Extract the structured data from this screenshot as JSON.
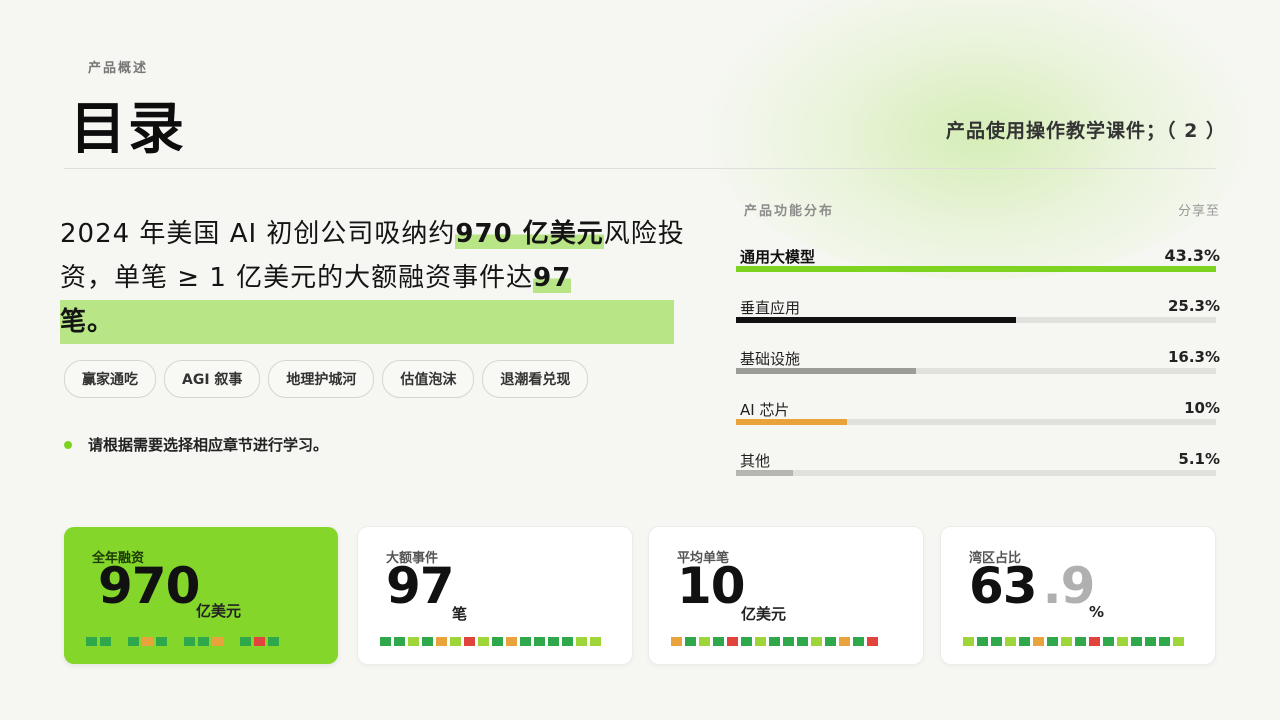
{
  "header": {
    "eyebrow": "产品概述",
    "title": "目录",
    "subtitle": "产品使用操作教学课件；（ 2 ）"
  },
  "lead": {
    "part1": "2024 年美国 AI 初创公司吸纳约",
    "highlight1": "970 亿美元",
    "part2": "风险投资，单笔 ≥ 1 亿美元的大额融资事件达",
    "highlight2": "97",
    "part3": "笔。"
  },
  "tags": [
    "赢家通吃",
    "AGI 叙事",
    "地理护城河",
    "估值泡沫",
    "退潮看兑现"
  ],
  "note": "请根据需要选择相应章节进行学习。",
  "distribution": {
    "title": "产品功能分布",
    "share_label": "分享至",
    "items": [
      {
        "label": "通用大模型",
        "value_text": "43.3%",
        "value": 1.0,
        "color": "#7ed321"
      },
      {
        "label": "垂直应用",
        "value_text": "25.3%",
        "value": 0.584,
        "color": "#111111"
      },
      {
        "label": "基础设施",
        "value_text": "16.3%",
        "value": 0.376,
        "color": "#9b9c96"
      },
      {
        "label": "AI 芯片",
        "value_text": "10%",
        "value": 0.231,
        "color": "#e8a33d"
      },
      {
        "label": "其他",
        "value_text": "5.1%",
        "value": 0.118,
        "color": "#b5b5b2"
      }
    ]
  },
  "cards": [
    {
      "label": "全年融资",
      "value": "970",
      "fraction": "",
      "unit": "亿美元"
    },
    {
      "label": "大额事件",
      "value": "97",
      "fraction": "",
      "unit": "笔"
    },
    {
      "label": "平均单笔",
      "value": "10",
      "fraction": "",
      "unit": "亿美元"
    },
    {
      "label": "湾区占比",
      "value": "63",
      "fraction": ".9",
      "unit": "%"
    }
  ],
  "colors": {
    "accent": "#84d62b",
    "highlight": "#b8e586",
    "sq_green": "#2ea84a",
    "sq_lime": "#9ed63a",
    "sq_orange": "#e8a33d",
    "sq_red": "#e0443c"
  },
  "strips": [
    [
      "g",
      "g",
      "_",
      "g",
      "o",
      "g",
      "_",
      "g",
      "g",
      "o",
      "_",
      "g",
      "r",
      "g"
    ],
    [
      "g",
      "g",
      "l",
      "g",
      "o",
      "l",
      "r",
      "l",
      "g",
      "o",
      "g",
      "g",
      "g",
      "g",
      "l",
      "l"
    ],
    [
      "o",
      "g",
      "l",
      "g",
      "r",
      "g",
      "l",
      "g",
      "g",
      "g",
      "l",
      "g",
      "o",
      "g",
      "r"
    ],
    [
      "l",
      "g",
      "g",
      "l",
      "g",
      "o",
      "g",
      "l",
      "g",
      "r",
      "g",
      "l",
      "g",
      "g",
      "g",
      "l"
    ]
  ]
}
